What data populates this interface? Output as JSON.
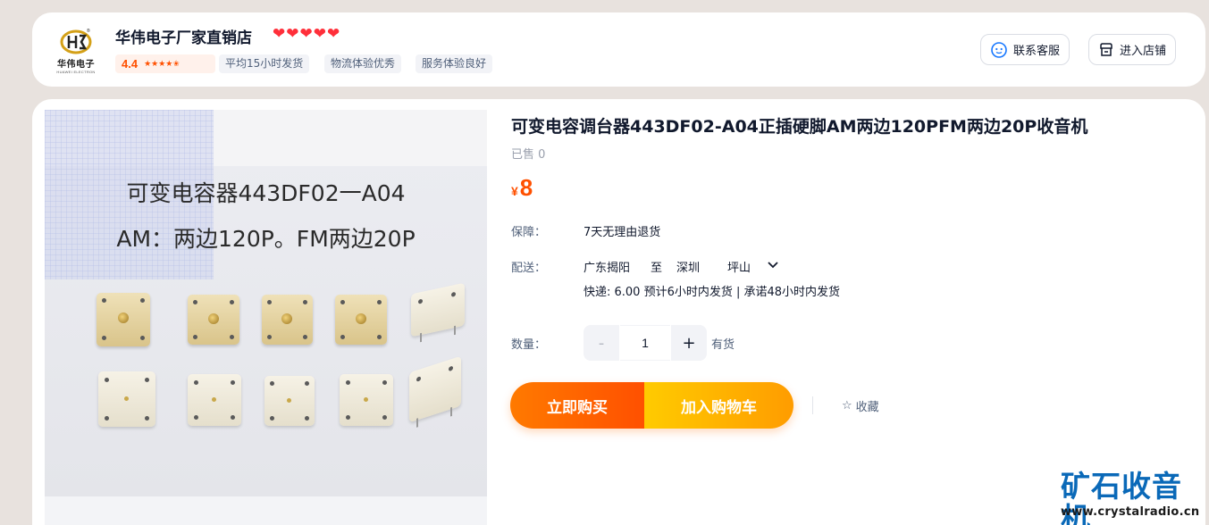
{
  "shop": {
    "logo_text": "华伟电子",
    "logo_sub": "HUAWEI ELECTRON",
    "name": "华伟电子厂家直销店",
    "hearts": [
      "❤",
      "❤",
      "❤",
      "❤",
      "❤"
    ],
    "rating": "4.4",
    "rating_stars": "★★★★✬",
    "tags": [
      "平均15小时发货",
      "物流体验优秀",
      "服务体验良好"
    ],
    "contact_label": "联系客服",
    "enter_store_label": "进入店铺",
    "colors": {
      "heart": "#ff2f3a",
      "accent": "#ff5000"
    }
  },
  "product": {
    "image_text_line1": "可变电容器443DF02一A04",
    "image_text_line2": "AM：两边120P。FM两边20P",
    "title": "可变电容调台器443DF02-A04正插硬脚AM两边120PFM两边20P收音机",
    "sold": "已售 0",
    "price_currency": "¥",
    "price": "8",
    "guarantee_label": "保障：",
    "guarantee_value": "7天无理由退货",
    "shipping_label": "配送：",
    "ship_from": "广东揭阳",
    "ship_to_word": "至",
    "ship_city": "深圳",
    "ship_district": "坪山",
    "shipping_detail": "快递: 6.00  预计6小时内发货 | 承诺48小时内发货",
    "quantity_label": "数量：",
    "quantity_minus": "-",
    "quantity_value": "1",
    "quantity_plus": "+",
    "stock": "有货",
    "buy_now": "立即购买",
    "add_to_cart": "加入购物车",
    "favorite": "收藏",
    "favorite_icon": "☆"
  },
  "watermark": {
    "title": "矿石收音机",
    "url": "www.crystalradio.cn"
  }
}
